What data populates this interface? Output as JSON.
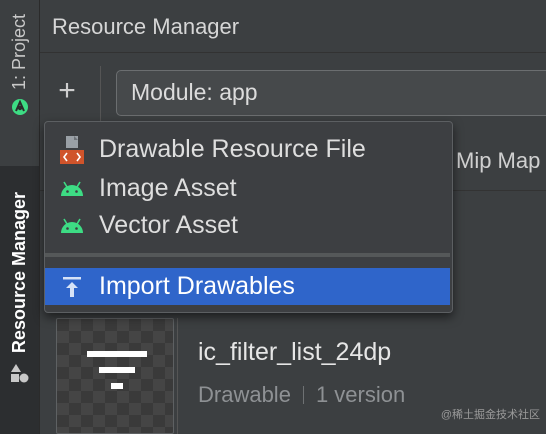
{
  "window": {
    "title": "Resource Manager"
  },
  "side_tabs": {
    "project": "1: Project",
    "resource_manager": "Resource Manager"
  },
  "toolbar": {
    "add_label": "+",
    "module_select": "Module: app"
  },
  "tabs": {
    "mip_map": "Mip Map"
  },
  "add_menu": {
    "items": [
      {
        "label": "Drawable Resource File",
        "icon": "drawable-file-icon"
      },
      {
        "label": "Image Asset",
        "icon": "android-icon"
      },
      {
        "label": "Vector Asset",
        "icon": "android-icon"
      },
      {
        "label": "Import Drawables",
        "icon": "import-arrow-icon",
        "selected": true
      }
    ]
  },
  "resource": {
    "name": "ic_filter_list_24dp",
    "type": "Drawable",
    "versions": "1 version"
  },
  "watermark": "@稀土掘金技术社区",
  "colors": {
    "selection": "#2f65ca",
    "android_green": "#3ddc84",
    "background": "#3c3f41"
  }
}
